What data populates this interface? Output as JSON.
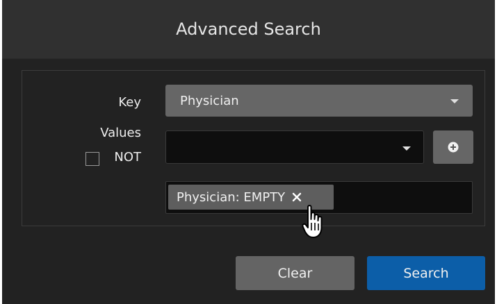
{
  "dialog": {
    "title": "Advanced Search"
  },
  "form": {
    "key_label": "Key",
    "key_value": "Physician",
    "values_label": "Values",
    "not_label": "NOT",
    "not_checked": false,
    "value_select": "",
    "tags": [
      {
        "label": "Physician: EMPTY"
      }
    ]
  },
  "footer": {
    "clear_label": "Clear",
    "search_label": "Search"
  },
  "icons": {
    "dropdown": "chevron-down-icon",
    "add": "plus-circle-icon",
    "remove_tag": "close-icon",
    "cursor": "hand-pointer-icon"
  },
  "colors": {
    "primary": "#0c5ea8",
    "background": "#222222",
    "header": "#303030",
    "control": "#666666"
  }
}
